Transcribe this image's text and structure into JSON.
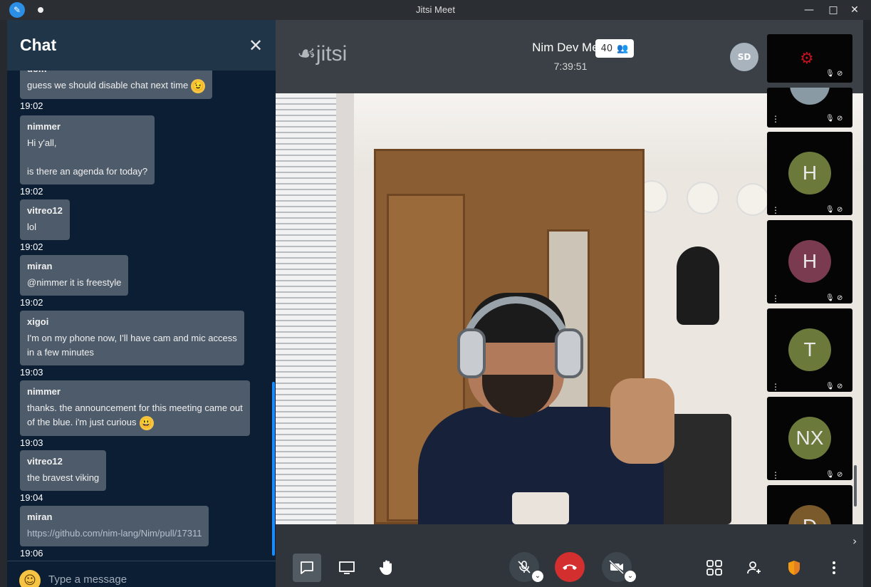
{
  "window": {
    "title": "Jitsi Meet",
    "controls": {
      "minimize": "—",
      "maximize": "□",
      "close": "✕"
    }
  },
  "chat": {
    "title": "Chat",
    "close_icon": "✕",
    "messages": [
      {
        "author": "dom",
        "lines": [
          "guess we should disable chat next time"
        ],
        "emoji": "wink",
        "time": "19:02"
      },
      {
        "author": "nimmer",
        "lines": [
          "Hi y'all,",
          "",
          "is there an agenda for today?"
        ],
        "time": "19:02"
      },
      {
        "author": "vitreo12",
        "lines": [
          "lol"
        ],
        "time": "19:02"
      },
      {
        "author": "miran",
        "lines": [
          "@nimmer it is freestyle"
        ],
        "time": "19:02"
      },
      {
        "author": "xigoi",
        "lines": [
          "I'm on my phone now, I'll have cam and mic access",
          "in a few minutes"
        ],
        "time": "19:03"
      },
      {
        "author": "nimmer",
        "lines": [
          "thanks. the announcement for this meeting came out",
          "of the blue. i'm just curious"
        ],
        "emoji": "smile",
        "time": "19:03"
      },
      {
        "author": "vitreo12",
        "lines": [
          "the bravest viking"
        ],
        "time": "19:04"
      },
      {
        "author": "miran",
        "lines": [
          "https://github.com/nim-lang/Nim/pull/17311"
        ],
        "link": true,
        "time": "19:06"
      }
    ],
    "input_placeholder": "Type a message"
  },
  "meeting": {
    "logo_text": "jitsi",
    "name": "Nim Dev Meet",
    "timer": "7:39:51",
    "participant_count": "40",
    "local_avatar": "SD"
  },
  "thumbnails": [
    {
      "kind": "logo"
    },
    {
      "kind": "video"
    },
    {
      "kind": "avatar",
      "initials": "H",
      "color": "#6b7a3a"
    },
    {
      "kind": "avatar",
      "initials": "H",
      "color": "#7a3a4f"
    },
    {
      "kind": "avatar",
      "initials": "T",
      "color": "#6b7a3a"
    },
    {
      "kind": "avatar",
      "initials": "NX",
      "color": "#6b7a3a"
    },
    {
      "kind": "avatar",
      "initials": "D",
      "color": "#7a5a2a"
    }
  ],
  "toolbar": {
    "chat_icon": "chat-icon",
    "screen_share_icon": "screen-share-icon",
    "raise_hand_icon": "raise-hand-icon",
    "mic_icon": "mic-muted-icon",
    "hangup_icon": "hangup-icon",
    "camera_icon": "camera-off-icon",
    "tile_view_icon": "tile-view-icon",
    "invite_icon": "invite-icon",
    "security_icon": "security-shield-icon",
    "more_icon": "more-icon"
  },
  "colors": {
    "accent": "#1a8cff",
    "hangup": "#d32f2f",
    "shield": "#f39c12"
  }
}
